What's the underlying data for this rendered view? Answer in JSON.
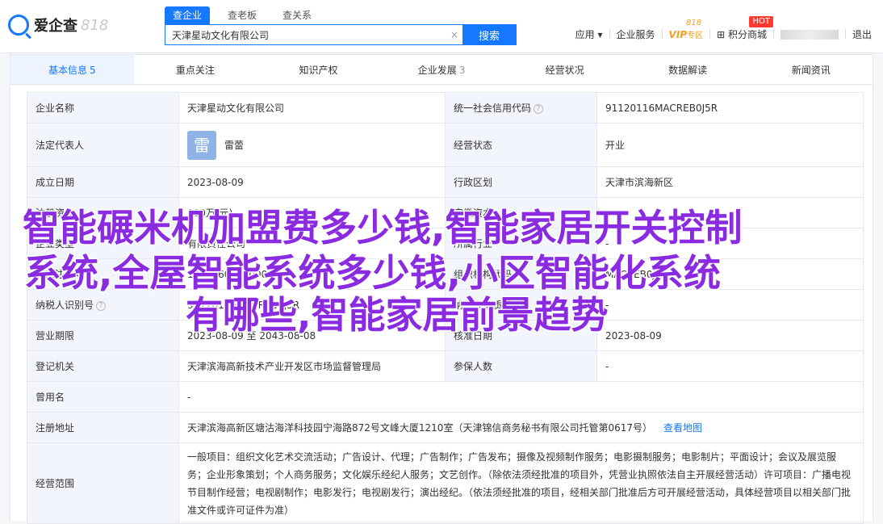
{
  "header": {
    "logo_text": "爱企查",
    "logo_num": "818",
    "search_tabs": [
      {
        "label": "查企业",
        "active": true
      },
      {
        "label": "查老板",
        "active": false
      },
      {
        "label": "查关系",
        "active": false
      }
    ],
    "search_value": "天津星动文化有限公司",
    "clear_icon": "×",
    "search_button": "搜索",
    "nav": {
      "app": "应用",
      "app_arrow": "▾",
      "enterprise_service": "企业服务",
      "vip": "VIP",
      "vip_suffix": "专区",
      "vip_sup": "818",
      "points_mall": "积分商城",
      "hot": "HOT",
      "logout": "退出"
    }
  },
  "tabs": [
    {
      "label": "基本信息",
      "count": "5",
      "active": true
    },
    {
      "label": "重点关注",
      "count": "",
      "active": false
    },
    {
      "label": "知识产权",
      "count": "",
      "active": false
    },
    {
      "label": "企业发展",
      "count": "3",
      "active": false
    },
    {
      "label": "经营状况",
      "count": "",
      "active": false
    },
    {
      "label": "数据解读",
      "count": "",
      "active": false
    },
    {
      "label": "新闻资讯",
      "count": "",
      "active": false
    }
  ],
  "info": {
    "rows": [
      {
        "l1": "企业名称",
        "v1": "天津星动文化有限公司",
        "l2": "统一社会信用代码",
        "v2": "91120116MACREB0J5R"
      },
      {
        "l1": "法定代表人",
        "v1": "雷蕾",
        "avatar": "雷",
        "l2": "经营状态",
        "v2": "开业"
      },
      {
        "l1": "成立日期",
        "v1": "2023-08-09",
        "l2": "行政区划",
        "v2": "天津市滨海新区"
      },
      {
        "l1": "注册资本",
        "v1": "800万(元)",
        "l2": "实缴资本",
        "v2": "-"
      },
      {
        "l1": "企业类型",
        "v1": "有限责任公司",
        "l2": "所属行业",
        "v2": "-"
      },
      {
        "l1": "工商注册号",
        "v1": "120116000000000",
        "l2": "组织机构代码",
        "v2": "MACREB0J5"
      },
      {
        "l1": "纳税人识别号",
        "v1": "91120116MACREB0J5R",
        "l2": "纳税人资质",
        "v2": "-"
      },
      {
        "l1": "营业期限",
        "v1": "2023-08-09 至 2043-08-08",
        "l2": "核准日期",
        "v2": "2023-08-09"
      },
      {
        "l1": "登记机关",
        "v1": "天津滨海高新技术产业开发区市场监督管理局",
        "l2": "参保人数",
        "v2": "-"
      }
    ],
    "former_name_label": "曾用名",
    "former_name": "-",
    "address_label": "注册地址",
    "address": "天津滨海高新区塘沽海洋科技园宁海路872号文峰大厦1210室（天津锦信商务秘书有限公司托管第0617号）",
    "map_link": "查看地图",
    "scope_label": "经营范围",
    "scope": "一般项目：组织文化艺术交流活动；广告设计、代理；广告制作；广告发布；摄像及视频制作服务；电影摄制服务；电影制片；平面设计；会议及展览服务；企业形象策划；个人商务服务；文化娱乐经纪人服务；文艺创作。（除依法须经批准的项目外，凭营业执照依法自主开展经营活动）许可项目：广播电视节目制作经营；电视剧制作；电影发行；电视剧发行；演出经纪。（依法须经批准的项目，经相关部门批准后方可开展经营活动，具体经营项目以相关部门批准文件或许可证件为准）"
  },
  "overlay": {
    "line1": "智能碾米机加盟费多少钱,智能家居开关控制",
    "line2": "系统,全屋智能系统多少钱,小区智能化系统",
    "line3": "有哪些,智能家居前景趋势"
  }
}
